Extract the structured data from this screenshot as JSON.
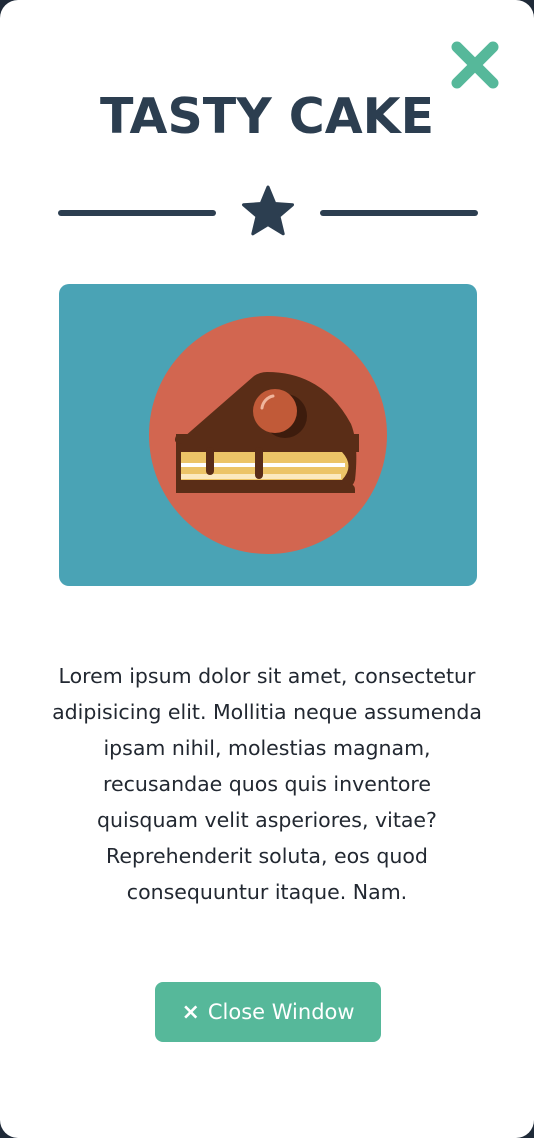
{
  "modal": {
    "title": "TASTY CAKE",
    "description": "Lorem ipsum dolor sit amet, consectetur adipisicing elit. Mollitia neque assumenda ipsam nihil, molestias magnam, recusandae quos quis inventore quisquam velit asperiores, vitae? Reprehenderit soluta, eos quod consequuntur itaque. Nam.",
    "close_button_label": "Close Window",
    "close_button_icon": "×",
    "icons": {
      "close": "close-x-icon",
      "divider": "star-icon",
      "image": "cake-slice-icon"
    }
  },
  "colors": {
    "title": "#2c3e50",
    "accent": "#56b89a",
    "image_background": "#4aa3b5",
    "plate_circle": "#d26650"
  }
}
